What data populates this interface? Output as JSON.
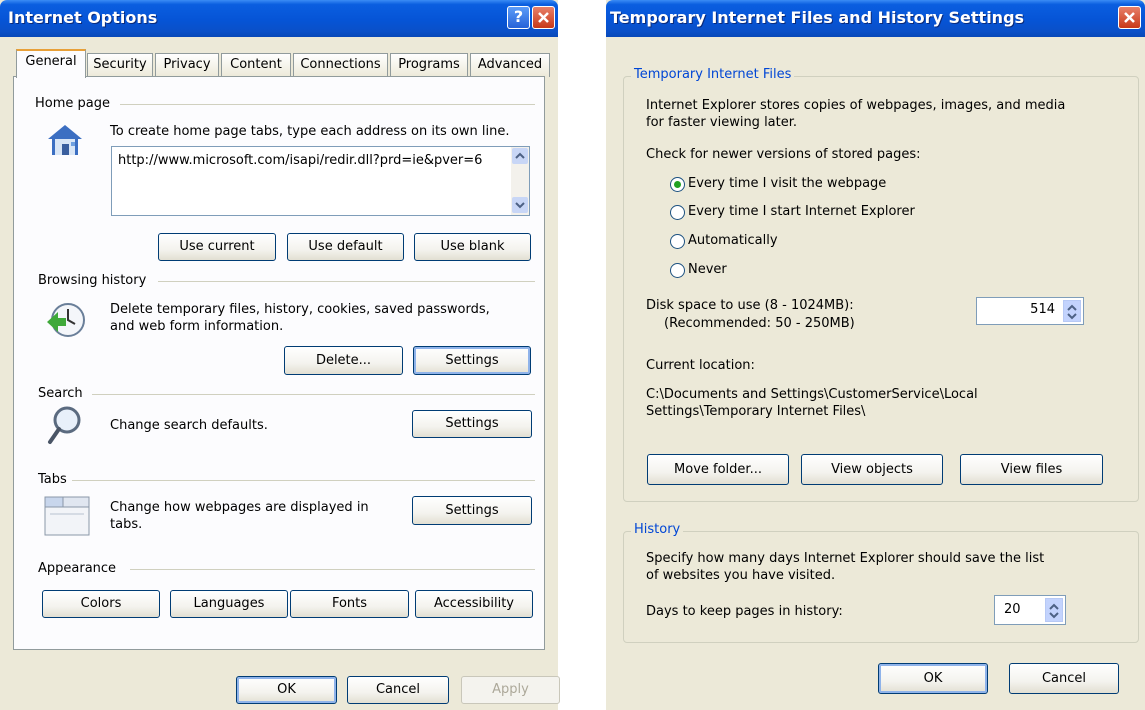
{
  "left_window": {
    "title": "Internet Options",
    "help_label": "?",
    "tabs": [
      "General",
      "Security",
      "Privacy",
      "Content",
      "Connections",
      "Programs",
      "Advanced"
    ],
    "home_page": {
      "section_title": "Home page",
      "description": "To create home page tabs, type each address on its own line.",
      "url_value": "http://www.microsoft.com/isapi/redir.dll?prd=ie&pver=6",
      "use_current": "Use current",
      "use_default": "Use default",
      "use_blank": "Use blank"
    },
    "browsing_history": {
      "section_title": "Browsing history",
      "description_line1": "Delete temporary files, history, cookies, saved passwords,",
      "description_line2": "and web form information.",
      "delete_button": "Delete...",
      "settings_button": "Settings"
    },
    "search": {
      "section_title": "Search",
      "description": "Change search defaults.",
      "settings_button": "Settings"
    },
    "tabs_section": {
      "section_title": "Tabs",
      "description_line1": "Change how webpages are displayed in",
      "description_line2": "tabs.",
      "settings_button": "Settings"
    },
    "appearance": {
      "section_title": "Appearance",
      "colors": "Colors",
      "languages": "Languages",
      "fonts": "Fonts",
      "accessibility": "Accessibility"
    },
    "footer": {
      "ok": "OK",
      "cancel": "Cancel",
      "apply": "Apply"
    }
  },
  "right_window": {
    "title": "Temporary Internet Files and History Settings",
    "temp_files": {
      "group_title": "Temporary Internet Files",
      "description_line1": "Internet Explorer stores copies of webpages, images, and media",
      "description_line2": "for faster viewing later.",
      "check_label": "Check for newer versions of stored pages:",
      "options": [
        "Every time I visit the webpage",
        "Every time I start Internet Explorer",
        "Automatically",
        "Never"
      ],
      "selected_option": "Every time I visit the webpage",
      "disk_space_label": "Disk space to use (8 - 1024MB):",
      "recommended": "(Recommended: 50 - 250MB)",
      "disk_space_value": "514",
      "current_location_label": "Current location:",
      "location_line1": "C:\\Documents and Settings\\CustomerService\\Local",
      "location_line2": "Settings\\Temporary Internet Files\\",
      "move_folder": "Move folder...",
      "view_objects": "View objects",
      "view_files": "View files"
    },
    "history": {
      "group_title": "History",
      "description_line1": "Specify how many days Internet Explorer should save the list",
      "description_line2": "of websites you have visited.",
      "days_label": "Days to keep pages in history:",
      "days_value": "20"
    },
    "footer": {
      "ok": "OK",
      "cancel": "Cancel"
    }
  },
  "colors": {
    "title_bar": "#0654d6",
    "dialog_bg": "#ece9d8",
    "group_title": "#0046d5",
    "radio_dot": "#21a121",
    "close_button": "#c83818"
  }
}
